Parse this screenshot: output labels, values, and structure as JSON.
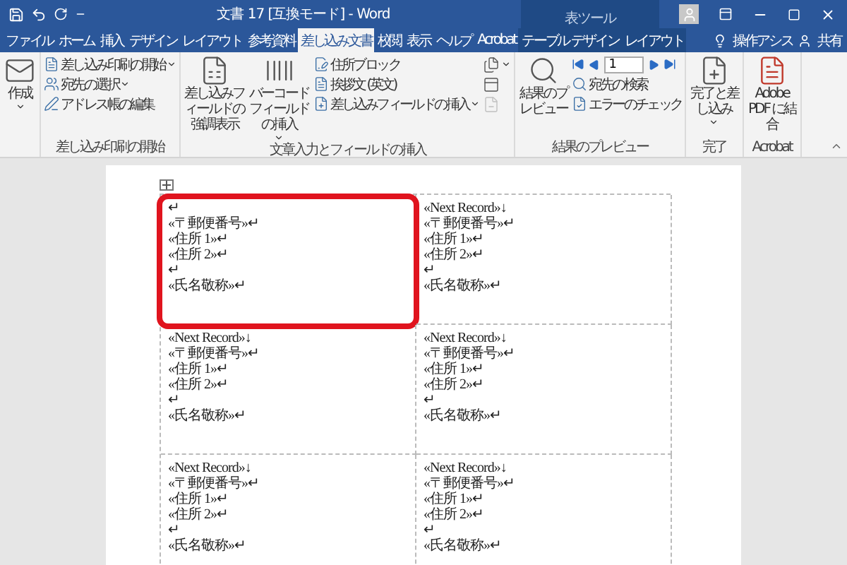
{
  "title_bar": {
    "title": "文書 17 [互換モード] - Word",
    "context_label": "表ツール"
  },
  "tabs": [
    {
      "label": "ファイル",
      "selected": false,
      "kind": "normal"
    },
    {
      "label": "ホーム",
      "selected": false,
      "kind": "normal"
    },
    {
      "label": "挿入",
      "selected": false,
      "kind": "normal"
    },
    {
      "label": "デザイン",
      "selected": false,
      "kind": "normal"
    },
    {
      "label": "レイアウト",
      "selected": false,
      "kind": "normal"
    },
    {
      "label": "参考資料",
      "selected": false,
      "kind": "normal"
    },
    {
      "label": "差し込み文書",
      "selected": true,
      "kind": "normal"
    },
    {
      "label": "校閲",
      "selected": false,
      "kind": "normal"
    },
    {
      "label": "表示",
      "selected": false,
      "kind": "normal"
    },
    {
      "label": "ヘルプ",
      "selected": false,
      "kind": "normal"
    },
    {
      "label": "Acrobat",
      "selected": false,
      "kind": "normal"
    },
    {
      "label": "テーブル デザイン",
      "selected": false,
      "kind": "context"
    },
    {
      "label": "レイアウト",
      "selected": false,
      "kind": "context"
    }
  ],
  "tell_me": "操作アシス",
  "share": "共有",
  "ribbon": {
    "groups": [
      {
        "columns": [
          [
            {
              "kind": "big",
              "label": "作成",
              "dropdown": true
            }
          ]
        ]
      },
      {
        "label": "差し込み印刷の開始",
        "columns": [
          [
            {
              "kind": "small",
              "label": "差し込み印刷の開始",
              "dropdown": true
            },
            {
              "kind": "small",
              "label": "宛先の選択",
              "dropdown": true
            },
            {
              "kind": "small",
              "label": "アドレス帳の編集",
              "dropdown": false
            }
          ]
        ]
      },
      {
        "label": "文章入力とフィールドの挿入",
        "columns": [
          [
            {
              "kind": "big",
              "label": "差し込みフィールドの強調表示",
              "dropdown": false
            }
          ],
          [
            {
              "kind": "big",
              "label": "バーコードフィールドの挿入",
              "dropdown": true
            }
          ],
          [
            {
              "kind": "small",
              "label": "住所ブロック",
              "dropdown": false
            },
            {
              "kind": "small",
              "label": "挨拶文 (英文)",
              "dropdown": false
            },
            {
              "kind": "small",
              "label": "差し込みフィールドの挿入",
              "dropdown": true
            }
          ],
          [
            {
              "kind": "icon",
              "dropdown": true,
              "disabled": false
            },
            {
              "kind": "icon",
              "dropdown": false,
              "disabled": false
            },
            {
              "kind": "icon",
              "dropdown": false,
              "disabled": true
            }
          ]
        ]
      },
      {
        "label": "結果のプレビュー",
        "columns": [
          [
            {
              "kind": "big",
              "label": "結果のプレビュー",
              "dropdown": false
            }
          ],
          [
            {
              "kind": "nav",
              "record": "1"
            },
            {
              "kind": "small",
              "label": "宛先の検索",
              "dropdown": false
            },
            {
              "kind": "small",
              "label": "エラーのチェック",
              "dropdown": false
            }
          ]
        ]
      },
      {
        "label": "完了",
        "columns": [
          [
            {
              "kind": "big",
              "label": "完了と差し込み",
              "dropdown": true
            }
          ]
        ]
      },
      {
        "label": "Acrobat",
        "columns": [
          [
            {
              "kind": "big",
              "label": "Adobe PDF に結合",
              "dropdown": false
            }
          ]
        ]
      }
    ]
  },
  "table": {
    "rows": [
      [
        {
          "highlighted": true,
          "lines": [
            "↵",
            "«〒郵便番号»↵",
            "«住所 1»↵",
            "«住所 2»↵",
            "↵",
            "«氏名敬称»↵"
          ]
        },
        {
          "highlighted": false,
          "lines": [
            "«Next Record»↓",
            "«〒郵便番号»↵",
            "«住所 1»↵",
            "«住所 2»↵",
            "↵",
            "«氏名敬称»↵"
          ]
        }
      ],
      [
        {
          "highlighted": false,
          "lines": [
            "«Next Record»↓",
            "«〒郵便番号»↵",
            "«住所 1»↵",
            "«住所 2»↵",
            "↵",
            "«氏名敬称»↵"
          ]
        },
        {
          "highlighted": false,
          "lines": [
            "«Next Record»↓",
            "«〒郵便番号»↵",
            "«住所 1»↵",
            "«住所 2»↵",
            "↵",
            "«氏名敬称»↵"
          ]
        }
      ],
      [
        {
          "highlighted": false,
          "lines": [
            "«Next Record»↓",
            "«〒郵便番号»↵",
            "«住所 1»↵",
            "«住所 2»↵",
            "↵",
            "«氏名敬称»↵"
          ]
        },
        {
          "highlighted": false,
          "lines": [
            "«Next Record»↓",
            "«〒郵便番号»↵",
            "«住所 1»↵",
            "«住所 2»↵",
            "↵",
            "«氏名敬称»↵"
          ]
        }
      ]
    ]
  }
}
